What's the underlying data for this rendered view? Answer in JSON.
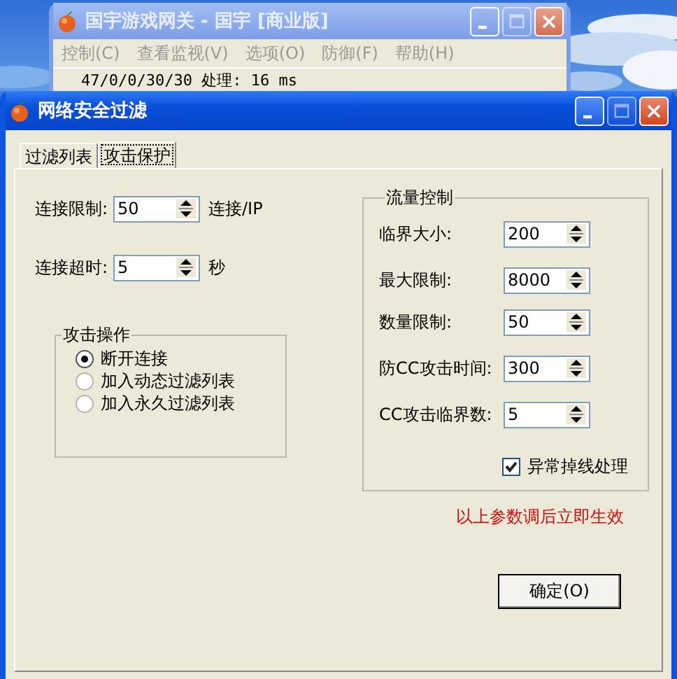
{
  "back_window": {
    "title": "国宇游戏网关 - 国宇 [商业版]",
    "menu": [
      "控制(C)",
      "查看监视(V)",
      "选项(O)",
      "防御(F)",
      "帮助(H)"
    ],
    "status": "47/0/0/30/30  处理: 16 ms"
  },
  "window": {
    "title": "网络安全过滤",
    "tabs": [
      {
        "label": "过滤列表",
        "selected": false
      },
      {
        "label": "攻击保护",
        "selected": true
      }
    ],
    "connection_fields": [
      {
        "label": "连接限制:",
        "value": "50",
        "unit": "连接/IP"
      },
      {
        "label": "连接超时:",
        "value": "5",
        "unit": "秒"
      }
    ],
    "attack_action": {
      "title": "攻击操作",
      "options": [
        {
          "label": "断开连接",
          "selected": true
        },
        {
          "label": "加入动态过滤列表",
          "selected": false
        },
        {
          "label": "加入永久过滤列表",
          "selected": false
        }
      ]
    },
    "flow_control": {
      "title": "流量控制",
      "fields": [
        {
          "label": "临界大小:",
          "value": "200"
        },
        {
          "label": "最大限制:",
          "value": "8000"
        },
        {
          "label": "数量限制:",
          "value": "50"
        },
        {
          "label": "防CC攻击时间:",
          "value": "300"
        },
        {
          "label": "CC攻击临界数:",
          "value": "5"
        }
      ],
      "checkbox": {
        "label": "异常掉线处理",
        "checked": true
      }
    },
    "note": "以上参数调后立即生效",
    "buttons": [
      "确定(O)"
    ]
  }
}
